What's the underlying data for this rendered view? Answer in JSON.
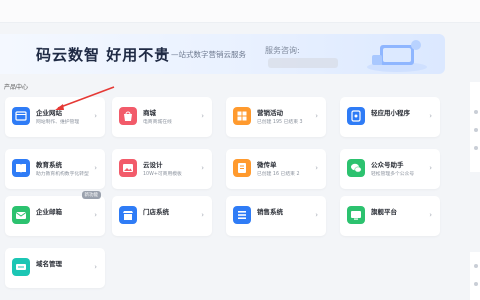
{
  "banner": {
    "brand": "码云数智  好用不贵",
    "subtitle": "—站式数字营销云服务",
    "service_label": "服务咨询:"
  },
  "section": {
    "title": "产品中心"
  },
  "colors": {
    "blue": "#2f7cf6",
    "red": "#f25b6a",
    "orange": "#ff9a2e",
    "green": "#2cc26f",
    "teal": "#1cc6b4"
  },
  "cards": [
    {
      "title": "企业网站",
      "desc": "网站制作、维护管理",
      "badge": ""
    },
    {
      "title": "商城",
      "desc": "电商商城在线",
      "badge": ""
    },
    {
      "title": "营销活动",
      "desc": "已创建 195  已结束 3",
      "badge": ""
    },
    {
      "title": "轻应用小程序",
      "desc": "",
      "badge": ""
    },
    {
      "title": "教育系统",
      "desc": "助力教育机构数字化转型",
      "badge": ""
    },
    {
      "title": "云设计",
      "desc": "10W+可商用模板",
      "badge": ""
    },
    {
      "title": "微传单",
      "desc": "已创建 16  已结束 2",
      "badge": ""
    },
    {
      "title": "公众号助手",
      "desc": "轻松管理多个公众号",
      "badge": ""
    },
    {
      "title": "企业邮箱",
      "desc": "",
      "badge": "新功能"
    },
    {
      "title": "门店系统",
      "desc": "",
      "badge": ""
    },
    {
      "title": "销售系统",
      "desc": "",
      "badge": ""
    },
    {
      "title": "旗舰平台",
      "desc": "",
      "badge": ""
    },
    {
      "title": "域名管理",
      "desc": "",
      "badge": ""
    }
  ]
}
